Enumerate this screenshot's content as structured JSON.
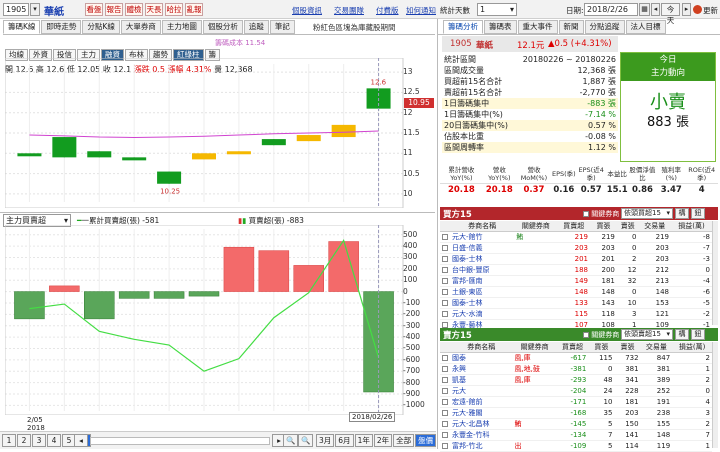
{
  "topbar": {
    "stock": "1905",
    "name": "華紙",
    "buttons": [
      "看盤",
      "報告",
      "體檢",
      "天長",
      "哈拉",
      "亂報"
    ],
    "links": [
      "個股資訊",
      "交易團隊",
      "付費版",
      "如何通知"
    ],
    "range_label": "統計天數",
    "range_value": "1",
    "date_label": "日期:",
    "date_value": "2018/2/26",
    "today": "今天",
    "refresh": "更新"
  },
  "left_tabs": [
    "籌碼K線",
    "即時走勢",
    "分點K線",
    "大單券商",
    "主力地圖",
    "個股分析",
    "追蹤",
    "筆記"
  ],
  "sub_tabs": [
    "均線",
    "外資",
    "投信",
    "主力",
    "融資",
    "布林",
    "趨勢",
    "紅綠柱",
    "籌"
  ],
  "notice": "粉紅色區塊為庫藏股期間",
  "ohlc": {
    "open_label": "開",
    "open": "12.6",
    "high_label": "高",
    "high": "12.6",
    "low_label": "低",
    "low": "12.05",
    "close_label": "收",
    "close": "12.1",
    "chg_label": "漲跌",
    "chg": "0.5",
    "pct_label": "漲幅",
    "pct": "4.31%",
    "vol_label": "量",
    "vol": "12,368"
  },
  "main_chart": {
    "avg_label": "籌碼成本 11.54",
    "hi_label": "12.6",
    "lo_label": "10.25",
    "price_tag": "10.95",
    "y_ticks": [
      "13",
      "12.5",
      "12",
      "11.5",
      "11",
      "10.5",
      "10"
    ]
  },
  "sub_chart": {
    "select": "主力買賣超",
    "legend1": "一累計買賣超(張) -581",
    "legend2": "買賣超(張) -883",
    "y_ticks": [
      "500",
      "400",
      "300",
      "200",
      "100",
      "0",
      "-100",
      "-200",
      "-300",
      "-400",
      "-500",
      "-600",
      "-700",
      "-800",
      "-900",
      "-1000"
    ],
    "x_start": "2/05",
    "x_year": "2018",
    "cursor_date": "2018/02/26"
  },
  "bottom": {
    "pages": [
      "1",
      "2",
      "3",
      "4",
      "5",
      "6"
    ],
    "periods": [
      "3月",
      "6月",
      "1年",
      "2年",
      "全部",
      "盤價"
    ]
  },
  "right_tabs": [
    "籌碼分析",
    "籌碼表",
    "重大事件",
    "新聞",
    "分點追蹤",
    "法人目標"
  ],
  "quote": {
    "code": "1905",
    "name": "華紙",
    "price": "12.1元",
    "chg": "▲0.5 (+4.31%)"
  },
  "stats": [
    {
      "k": "統計區間",
      "v": "20180226 ~ 20180226",
      "cls": ""
    },
    {
      "k": "區間成交量",
      "v": "12,368 張",
      "cls": ""
    },
    {
      "k": "買超前15名合計",
      "v": "1,887 張",
      "cls": ""
    },
    {
      "k": "賣超前15名合計",
      "v": "-2,770 張",
      "cls": ""
    },
    {
      "k": "1日籌碼集中",
      "v": "-883 張",
      "cls": "g"
    },
    {
      "k": "1日籌碼集中(%)",
      "v": "-7.14 %",
      "cls": "g"
    },
    {
      "k": "20日籌碼集中(%)",
      "v": "0.57 %",
      "cls": ""
    },
    {
      "k": "佔股本比重",
      "v": "-0.08 %",
      "cls": ""
    },
    {
      "k": "區間周轉率",
      "v": "1.12 %",
      "cls": ""
    }
  ],
  "today_box": {
    "title1": "今日",
    "title2": "主力動向",
    "word": "小賣",
    "value": "883 張"
  },
  "fin": {
    "headers": [
      "累計營收YoY(%)",
      "營收YoY(%)",
      "營收MoM(%)",
      "EPS(季)",
      "EPS(近4季)",
      "本益比",
      "股價淨值比",
      "殖利率(%)",
      "ROE(近4季)"
    ],
    "values": [
      "20.18",
      "20.18",
      "0.37",
      "0.16",
      "0.57",
      "15.1",
      "0.86",
      "3.47",
      "4"
    ]
  },
  "buy": {
    "title": "買方15",
    "assoc": "關鍵券商",
    "select": "依頭買超15",
    "btn1": "構",
    "btn2": "鈕",
    "cols": [
      "券商名稱",
      "關鍵券商",
      "買賣超",
      "買張",
      "賣張",
      "交易量",
      "損益(萬)"
    ],
    "rows": [
      [
        "元大-館竹",
        "鮪",
        "219",
        "219",
        "0",
        "219",
        "-8"
      ],
      [
        "日盛-信義",
        "",
        "203",
        "203",
        "0",
        "203",
        "-7"
      ],
      [
        "國泰-士林",
        "",
        "201",
        "201",
        "2",
        "203",
        "-3"
      ],
      [
        "台中銀-豐原",
        "",
        "188",
        "200",
        "12",
        "212",
        "0"
      ],
      [
        "富邦-匯南",
        "",
        "149",
        "181",
        "32",
        "213",
        "-4"
      ],
      [
        "土銀-東區",
        "",
        "148",
        "148",
        "0",
        "148",
        "-6"
      ],
      [
        "國泰-士林",
        "",
        "133",
        "143",
        "10",
        "153",
        "-5"
      ],
      [
        "元大-水湳",
        "",
        "115",
        "118",
        "3",
        "121",
        "-2"
      ],
      [
        "永豐-藝林",
        "",
        "107",
        "108",
        "1",
        "109",
        "-1"
      ]
    ]
  },
  "sell": {
    "title": "賣方15",
    "assoc": "關鍵券商",
    "select": "依頭賣超15",
    "btn1": "構",
    "btn2": "鈕",
    "cols": [
      "券商名稱",
      "關鍵券商",
      "買賣超",
      "買張",
      "賣張",
      "交易量",
      "損益(萬)"
    ],
    "rows": [
      [
        "國泰",
        "風,庫",
        "-617",
        "115",
        "732",
        "847",
        "2"
      ],
      [
        "永興",
        "風,地,鼓",
        "-381",
        "0",
        "381",
        "381",
        "1"
      ],
      [
        "凱基",
        "風,庫",
        "-293",
        "48",
        "341",
        "389",
        "2"
      ],
      [
        "元大",
        "",
        "-204",
        "24",
        "228",
        "252",
        "0"
      ],
      [
        "宏遠-館前",
        "",
        "-171",
        "10",
        "181",
        "191",
        "4"
      ],
      [
        "元大-雅閣",
        "",
        "-168",
        "35",
        "203",
        "238",
        "3"
      ],
      [
        "元大-北昌林",
        "鮪",
        "-145",
        "5",
        "150",
        "155",
        "2"
      ],
      [
        "永豐金-竹科",
        "",
        "-134",
        "7",
        "141",
        "148",
        "7"
      ],
      [
        "富邦-竹北",
        "出",
        "-109",
        "5",
        "114",
        "119",
        "1"
      ]
    ]
  },
  "kchart": {
    "candles": [
      {
        "o": 11.0,
        "h": 11.0,
        "l": 11.0,
        "c": 11.0,
        "up": false,
        "flat": true
      },
      {
        "o": 11.4,
        "h": 11.4,
        "l": 10.9,
        "c": 10.9,
        "up": false
      },
      {
        "o": 11.05,
        "h": 11.05,
        "l": 10.9,
        "c": 10.9,
        "up": false
      },
      {
        "o": 10.9,
        "h": 10.9,
        "l": 10.85,
        "c": 10.85,
        "up": false
      },
      {
        "o": 10.55,
        "h": 10.55,
        "l": 10.25,
        "c": 10.25,
        "up": false
      },
      {
        "o": 10.85,
        "h": 11.0,
        "l": 10.85,
        "c": 11.0,
        "up": true
      },
      {
        "o": 11.0,
        "h": 11.05,
        "l": 11.0,
        "c": 11.05,
        "up": true
      },
      {
        "o": 11.35,
        "h": 11.35,
        "l": 11.2,
        "c": 11.2,
        "up": false
      },
      {
        "o": 11.3,
        "h": 11.45,
        "l": 11.3,
        "c": 11.45,
        "up": true
      },
      {
        "o": 11.4,
        "h": 11.7,
        "l": 11.4,
        "c": 11.7,
        "up": true
      },
      {
        "o": 12.6,
        "h": 12.6,
        "l": 12.05,
        "c": 12.1,
        "up": false
      }
    ],
    "ma": [
      11.45,
      11.43,
      11.4,
      11.39,
      11.4,
      11.42,
      11.45,
      11.48,
      11.5,
      11.52,
      11.55
    ],
    "ymin": 9.8,
    "ymax": 13.2
  },
  "bars": {
    "values": [
      -240,
      50,
      -240,
      -60,
      -60,
      -40,
      390,
      360,
      230,
      440,
      -883
    ],
    "cum": [
      -150,
      -110,
      -350,
      -420,
      -470,
      -700,
      -590,
      -230,
      -10,
      450,
      -581
    ],
    "ymin": -1050,
    "ymax": 550
  }
}
